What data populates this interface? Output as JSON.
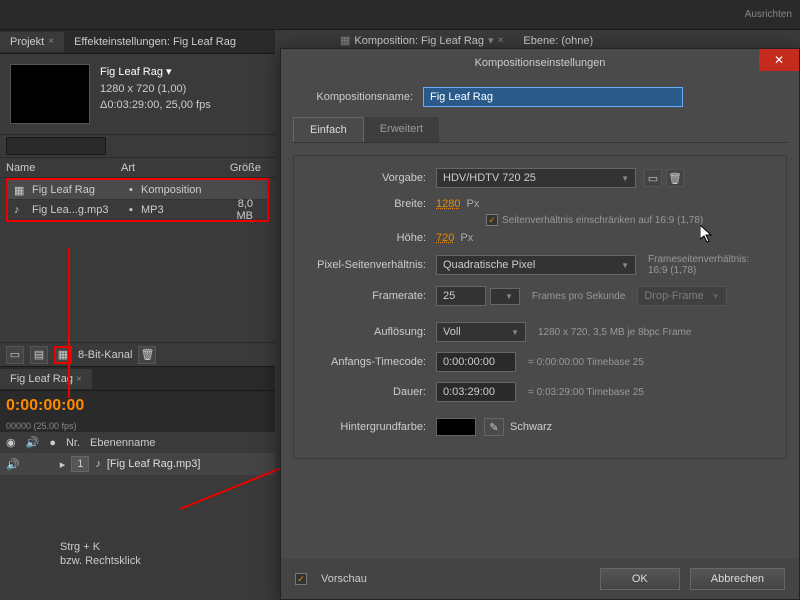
{
  "toolbar": {
    "align_label": "Ausrichten"
  },
  "tabs": {
    "project": "Projekt",
    "effect": "Effekteinstellungen: Fig Leaf Rag",
    "comp": "Komposition: Fig Leaf Rag",
    "layer": "Ebene: (ohne)"
  },
  "comp_info": {
    "name": "Fig Leaf Rag ▾",
    "dims": "1280 x 720 (1,00)",
    "dur": "Δ0:03:29:00, 25,00 fps"
  },
  "cols": {
    "name": "Name",
    "type": "Art",
    "size": "Größe"
  },
  "rows": [
    {
      "name": "Fig Leaf Rag",
      "type": "Komposition",
      "size": ""
    },
    {
      "name": "Fig Lea...g.mp3",
      "type": "MP3",
      "size": "8,0 MB"
    }
  ],
  "bit_depth": "8-Bit-Kanal",
  "timeline": {
    "tab": "Fig Leaf Rag",
    "tc": "0:00:00:00",
    "tc_sub": "00000 (25.00 fps)",
    "col_nr": "Nr.",
    "col_name": "Ebenenname",
    "layer_nr": "1",
    "layer_name": "[Fig Leaf Rag.mp3]"
  },
  "hint": {
    "l1": "Strg + K",
    "l2": "bzw. Rechtsklick"
  },
  "dlg": {
    "title": "Kompositionseinstellungen",
    "name_label": "Kompositionsname:",
    "name_value": "Fig Leaf Rag",
    "tab_basic": "Einfach",
    "tab_adv": "Erweitert",
    "preset_label": "Vorgabe:",
    "preset_value": "HDV/HDTV 720 25",
    "width_label": "Breite:",
    "width_value": "1280",
    "height_label": "Höhe:",
    "height_value": "720",
    "px": "Px",
    "lock_aspect": "Seitenverhältnis einschränken auf 16:9 (1,78)",
    "par_label": "Pixel-Seitenverhältnis:",
    "par_value": "Quadratische Pixel",
    "far_label": "Frameseitenverhältnis:",
    "far_value": "16:9 (1,78)",
    "fps_label": "Framerate:",
    "fps_value": "25",
    "fps_unit": "Frames pro Sekunde",
    "dropframe": "Drop-Frame",
    "res_label": "Auflösung:",
    "res_value": "Voll",
    "res_info": "1280 x 720, 3,5 MB je 8bpc Frame",
    "start_label": "Anfangs-Timecode:",
    "start_value": "0:00:00:00",
    "start_info": "= 0:00:00:00  Timebase 25",
    "dur_label": "Dauer:",
    "dur_value": "0:03:29:00",
    "dur_info": "= 0:03:29:00  Timebase 25",
    "bg_label": "Hintergrundfarbe:",
    "bg_name": "Schwarz",
    "preview": "Vorschau",
    "ok": "OK",
    "cancel": "Abbrechen"
  }
}
